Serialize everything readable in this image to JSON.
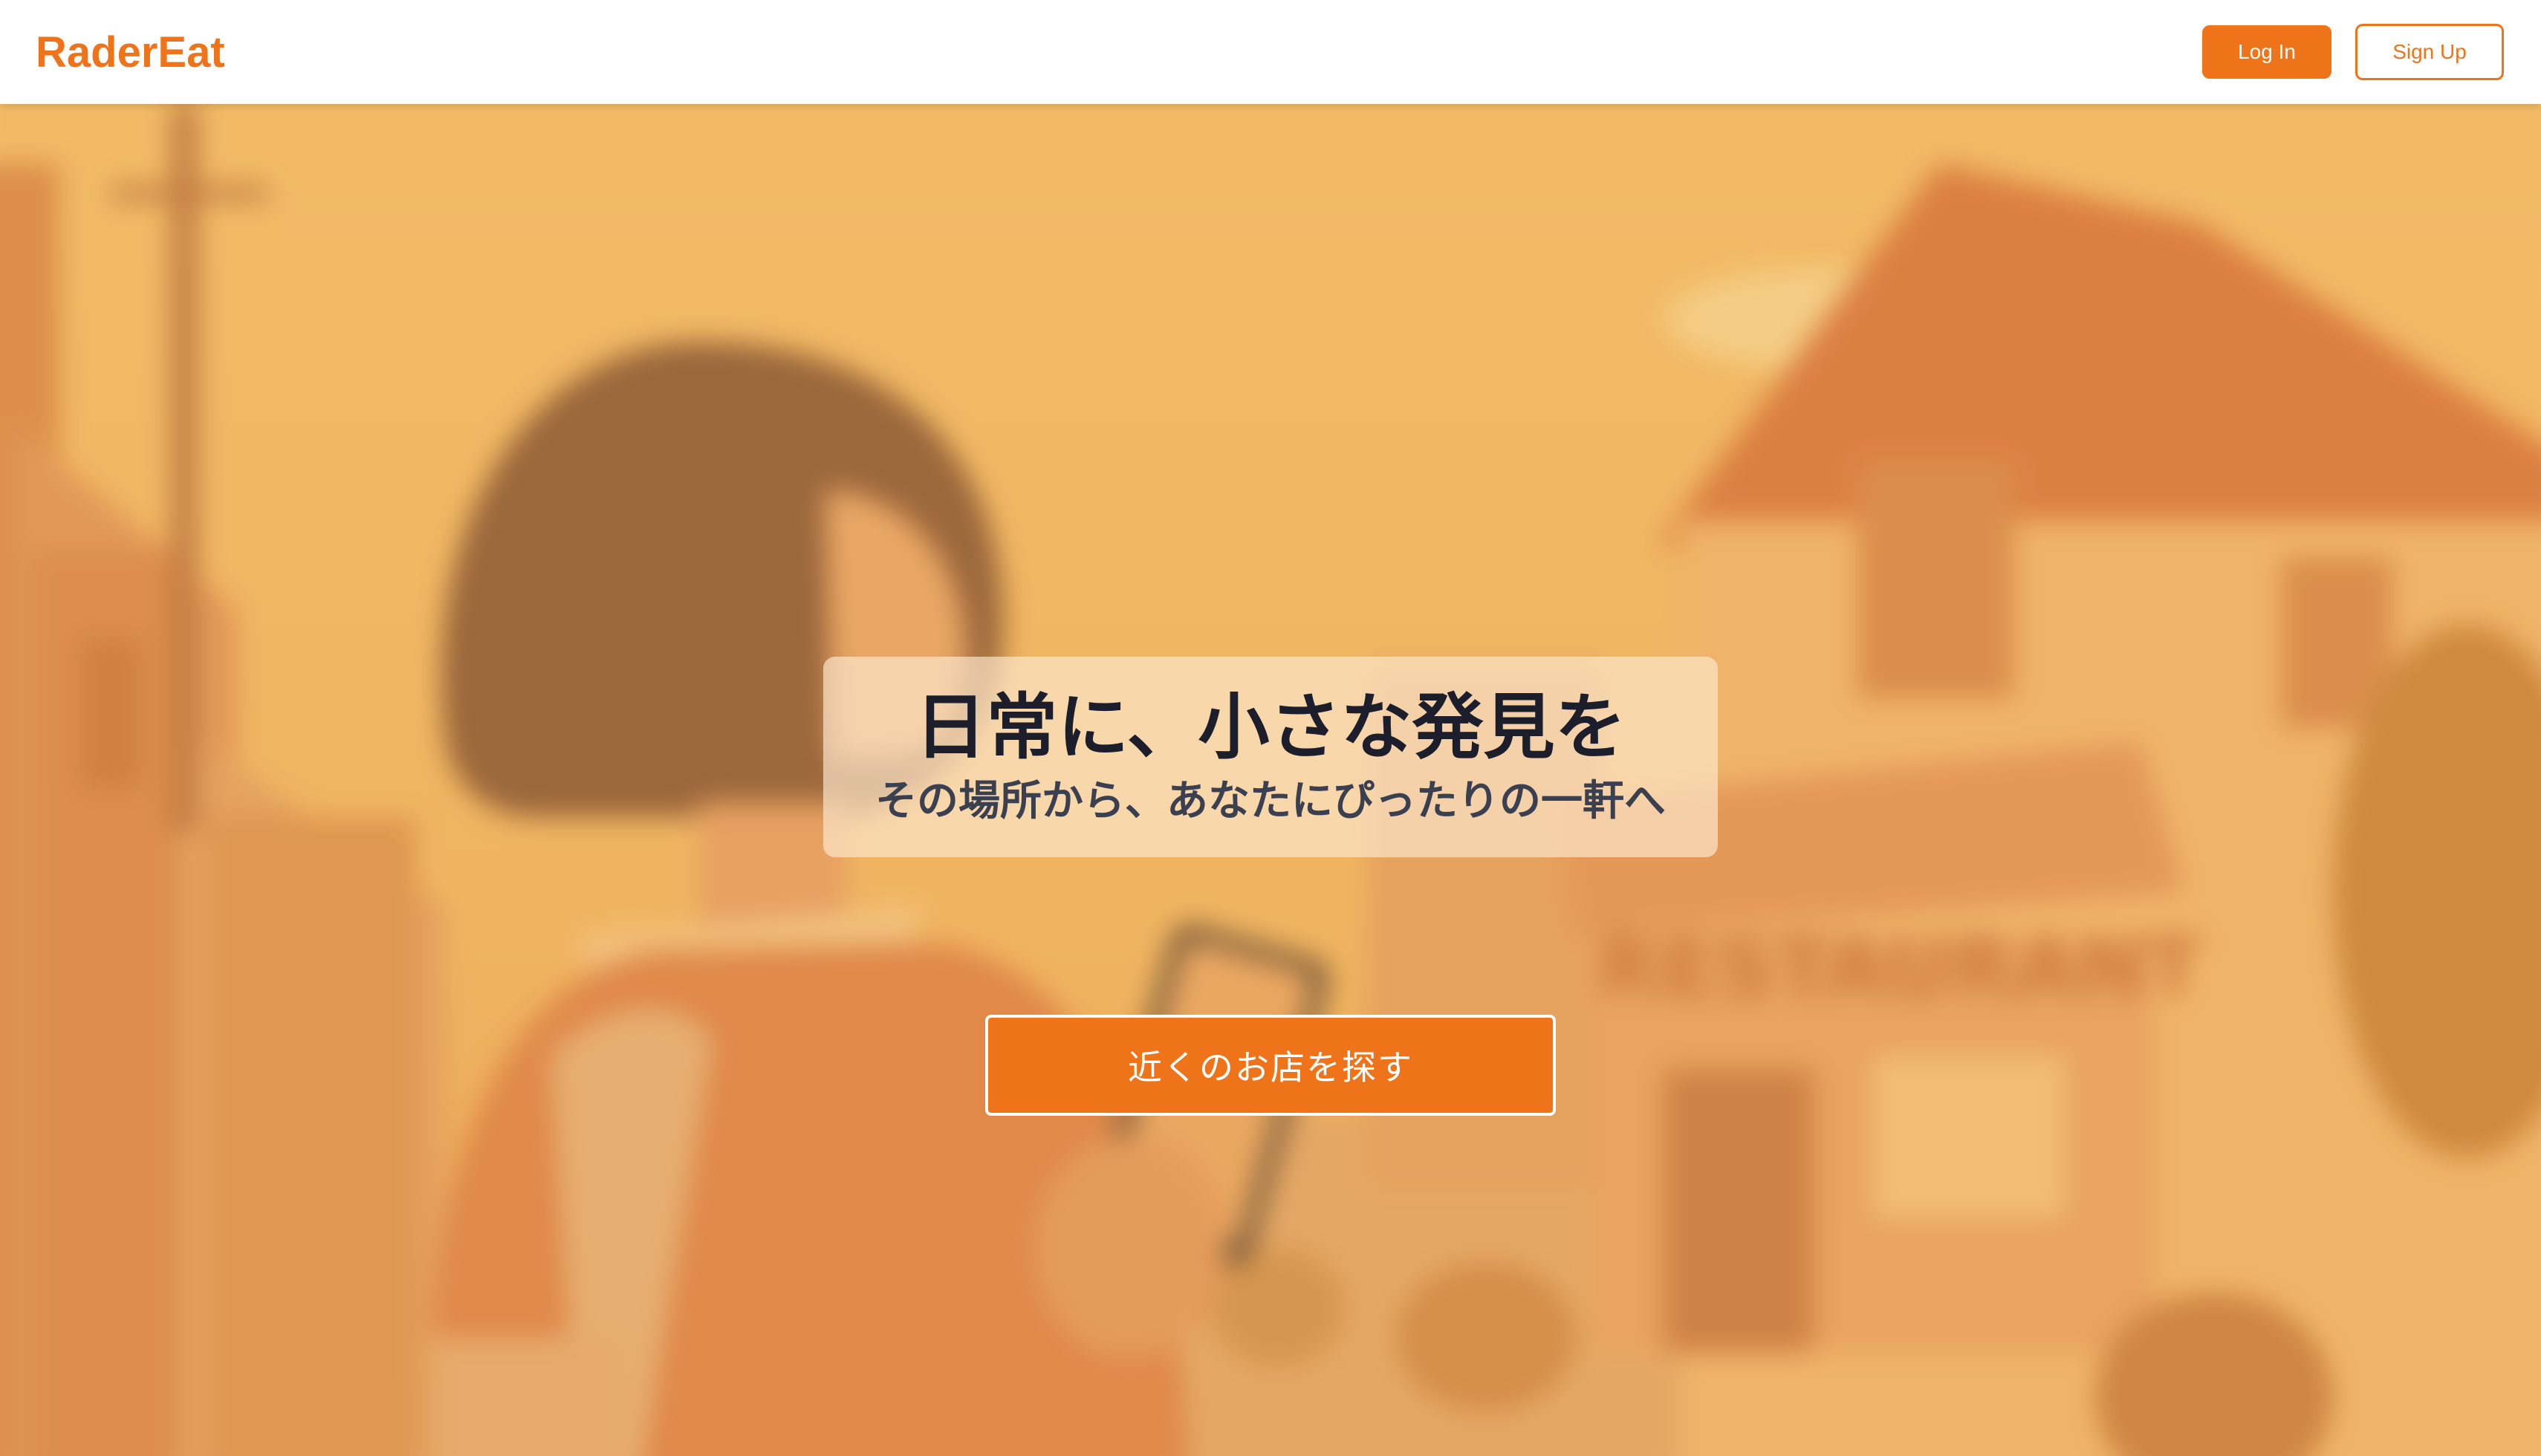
{
  "header": {
    "logo": "RaderEat",
    "login_label": "Log In",
    "signup_label": "Sign Up"
  },
  "hero": {
    "headline": "日常に、小さな発見を",
    "subheadline": "その場所から、あなたにぴったりの一軒へ",
    "cta_label": "近くのお店を探す",
    "background_sign": "RESTAURANT"
  },
  "colors": {
    "accent": "#ef7318",
    "headline_text": "#1c1f2b",
    "subheadline_text": "#3b4051"
  }
}
